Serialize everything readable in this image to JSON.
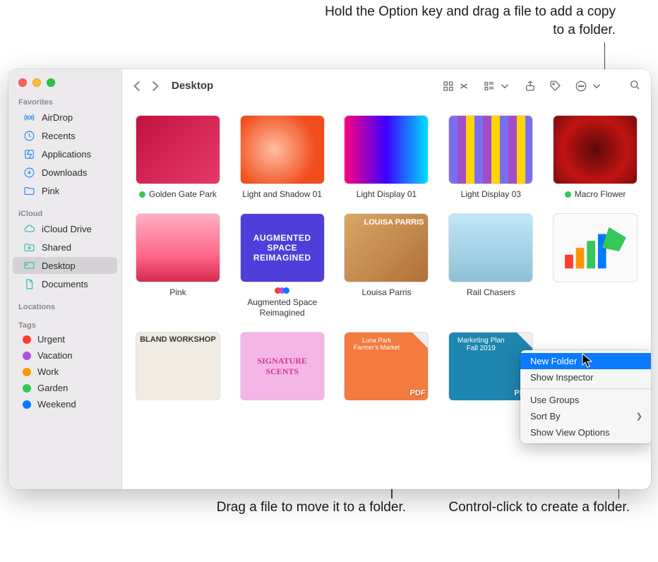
{
  "callouts": {
    "top": "Hold the Option key and drag a file to add a copy to a folder.",
    "bottom_left": "Drag a file to move it to a folder.",
    "bottom_right": "Control-click to create a folder."
  },
  "window": {
    "title": "Desktop"
  },
  "sidebar": {
    "favorites_title": "Favorites",
    "favorites": [
      {
        "label": "AirDrop"
      },
      {
        "label": "Recents"
      },
      {
        "label": "Applications"
      },
      {
        "label": "Downloads"
      },
      {
        "label": "Pink"
      }
    ],
    "icloud_title": "iCloud",
    "icloud": [
      {
        "label": "iCloud Drive"
      },
      {
        "label": "Shared"
      },
      {
        "label": "Desktop",
        "selected": true
      },
      {
        "label": "Documents"
      }
    ],
    "locations_title": "Locations",
    "tags_title": "Tags",
    "tags": [
      {
        "label": "Urgent",
        "color": "#ff3b30"
      },
      {
        "label": "Vacation",
        "color": "#af52de"
      },
      {
        "label": "Work",
        "color": "#ff9500"
      },
      {
        "label": "Garden",
        "color": "#34c759"
      },
      {
        "label": "Weekend",
        "color": "#007aff"
      }
    ]
  },
  "items": [
    {
      "label": "Golden Gate Park",
      "tag": "green"
    },
    {
      "label": "Light and Shadow 01"
    },
    {
      "label": "Light Display 01"
    },
    {
      "label": "Light Display 03"
    },
    {
      "label": "Macro Flower",
      "tag": "green"
    },
    {
      "label": "Pink"
    },
    {
      "label": "Augmented Space Reimagined",
      "multidot": true
    },
    {
      "label": "Louisa Parris"
    },
    {
      "label": "Rail Chasers"
    },
    {
      "label": ""
    },
    {
      "label": ""
    },
    {
      "label": ""
    },
    {
      "label": "",
      "pdf": true
    },
    {
      "label": "",
      "pdf": true
    }
  ],
  "thumb_text": {
    "r0c0": "",
    "r0c1": "",
    "r0c2": "",
    "r0c3": "",
    "r0c4": "",
    "r1c0": "",
    "r1c1": "AUGMENTED SPACE REIMAGINED",
    "r1c2": "LOUISA PARRIS",
    "r1c3": "",
    "r1c4": "",
    "r2c0": "BLAND WORKSHOP",
    "r2c1": "SIGNATURE SCENTS",
    "r2c2": "Luna Park Farmer's Market",
    "r2c3": "Marketing Plan Fall 2019"
  },
  "context_menu": {
    "new_folder": "New Folder",
    "show_inspector": "Show Inspector",
    "use_groups": "Use Groups",
    "sort_by": "Sort By",
    "show_view_options": "Show View Options"
  }
}
